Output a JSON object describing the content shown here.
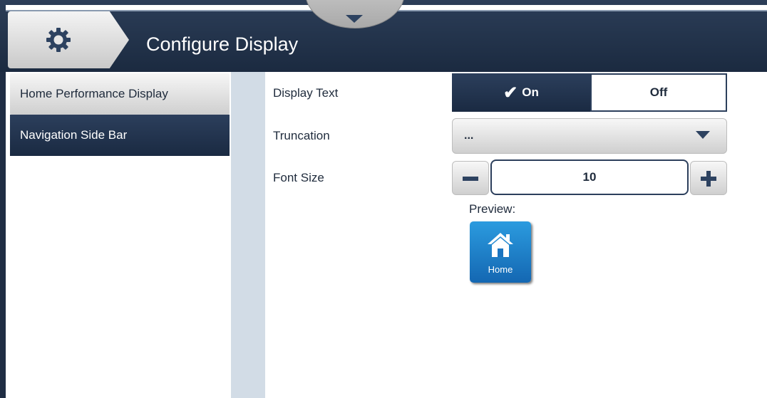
{
  "header": {
    "title": "Configure Display",
    "settings_icon": "gear-icon",
    "dropdown_icon": "chevron-down-icon"
  },
  "sidebar": {
    "items": [
      {
        "label": "Home Performance Display",
        "selected": false
      },
      {
        "label": "Navigation Side Bar",
        "selected": true
      }
    ]
  },
  "main": {
    "display_text": {
      "label": "Display Text",
      "on_label": "On",
      "off_label": "Off",
      "selected": "On",
      "check_icon": "✔"
    },
    "truncation": {
      "label": "Truncation",
      "value": "..."
    },
    "font_size": {
      "label": "Font Size",
      "value": "10"
    },
    "preview": {
      "label": "Preview:",
      "tile_label": "Home",
      "tile_icon": "home-icon"
    }
  },
  "colors": {
    "header_bg": "#1f2d44",
    "selected_bg": "#22344f",
    "accent_blue": "#1d7ccb",
    "divider": "#d2dce6"
  }
}
